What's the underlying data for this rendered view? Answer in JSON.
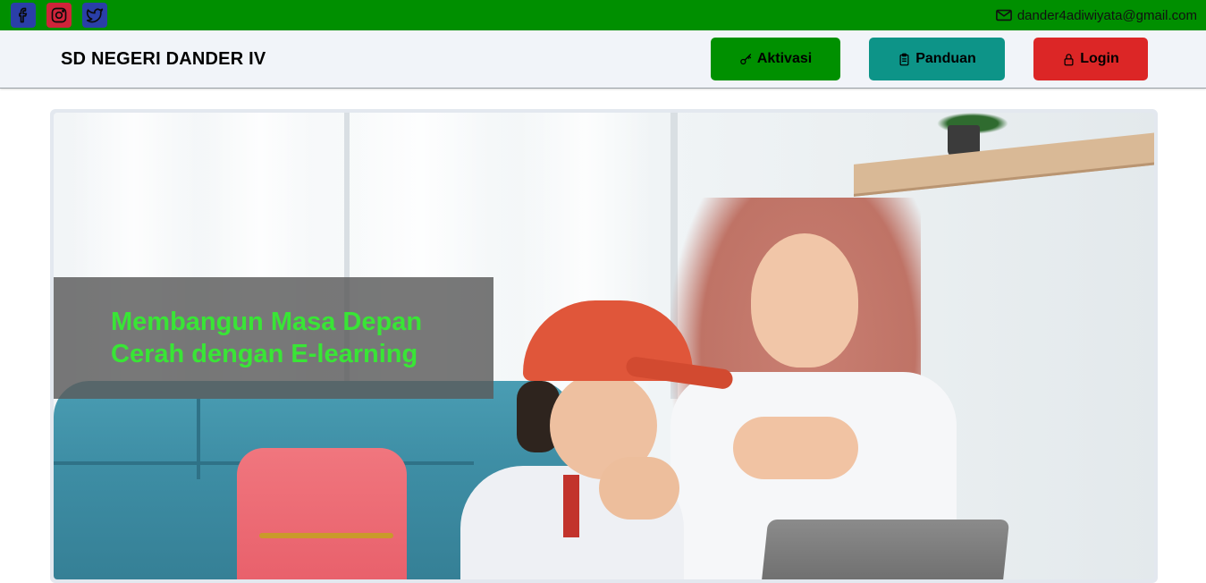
{
  "topbar": {
    "background": "#008f00",
    "social": [
      {
        "name": "facebook-icon",
        "color": "#2a3fa8"
      },
      {
        "name": "instagram-icon",
        "color": "#d0243a"
      },
      {
        "name": "twitter-icon",
        "color": "#2a3fa8"
      }
    ],
    "contact": {
      "icon": "mail-icon",
      "email": "dander4adiwiyata@gmail.com"
    }
  },
  "navbar": {
    "brand": "SD NEGERI DANDER IV",
    "buttons": [
      {
        "label": "Aktivasi",
        "icon": "key-icon",
        "color": "#009000"
      },
      {
        "label": "Panduan",
        "icon": "clipboard-icon",
        "color": "#0d9488"
      },
      {
        "label": "Login",
        "icon": "lock-icon",
        "color": "#dc2626"
      }
    ]
  },
  "hero": {
    "caption": "Membangun Masa Depan Cerah dengan E-learning",
    "caption_color": "#39e536"
  }
}
